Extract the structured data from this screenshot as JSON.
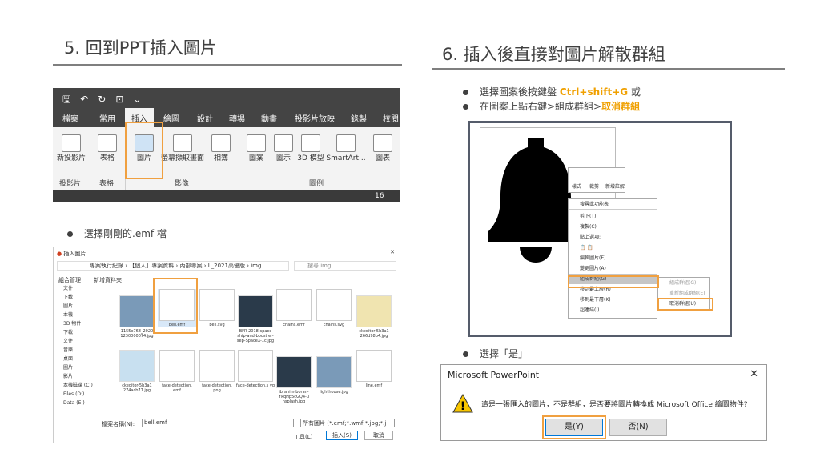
{
  "left": {
    "title": "5. 回到PPT插入圖片",
    "bullet": "選擇剛剛的.emf 檔"
  },
  "right": {
    "title": "6. 插入後直接對圖片解散群組",
    "bullet1": {
      "pre": "選擇圖案後按鍵盤 ",
      "key": "Ctrl+shift+G",
      "post": " 或"
    },
    "bullet2": {
      "pre": "在圖案上點右鍵>組成群組>",
      "key": "取消群組"
    },
    "bullet3": "選擇「是」"
  },
  "ribbon": {
    "tabs": [
      "檔案",
      "常用",
      "插入",
      "繪圖",
      "設計",
      "轉場",
      "動畫",
      "投影片放映",
      "錄製",
      "校閱"
    ],
    "buttons": [
      "新投影片",
      "表格",
      "圖片",
      "螢幕擷取畫面",
      "相簿",
      "圖案",
      "圖示",
      "3D 模型",
      "SmartArt...",
      "圖表"
    ],
    "groups": [
      "投影片",
      "表格",
      "影像",
      "圖例"
    ],
    "zoom": "16"
  },
  "dialog": {
    "title": "插入圖片",
    "path": [
      "專案執行紀錄",
      "【個人】專案資料",
      "內部專案",
      "L_2021高優版",
      "img"
    ],
    "search": "搜尋 img",
    "organize": "組合管理",
    "new_folder": "新增資料夾",
    "nav": [
      "文件",
      "下載",
      "圖片",
      "本機",
      "3D 物件",
      "下載",
      "文件",
      "音樂",
      "桌面",
      "圖片",
      "影片",
      "本機磁碟 (C:)",
      "Files (D:)",
      "Data (E:)"
    ],
    "files": [
      "1155x768_2020 1230000074.jpg",
      "bell.emf",
      "bell.svg",
      "BFR-2018-space ship-and-boost er-sep-SpaceX-1c.jpg",
      "chains.emf",
      "chains.svg",
      "ckeditor-5b3a1 266d98b4.jpg",
      "ckeditor-5b3a1 274acb77.jpg",
      "face-detection. emf",
      "face-detection. png",
      "face-detection.s vg",
      "ibrahim-boran- YkqHp5cGQ4-u nsplash.jpg",
      "lighthouse.jpg",
      "line.emf"
    ],
    "filename_label": "檔案名稱(N):",
    "filename": "bell.emf",
    "filter": "所有圖片 (*.emf;*.wmf;*.jpg;*.j",
    "tools": "工具(L)",
    "insert": "插入(S)",
    "cancel": "取消"
  },
  "context": {
    "mini": [
      "樣式",
      "裁剪",
      "新增註解"
    ],
    "search": "搜尋此功能表",
    "items": [
      "剪下(T)",
      "複製(C)",
      "貼上選項:",
      "",
      "編輯圖片(E)",
      "變更圖片(A)",
      "組成群組(G)",
      "移到最上層(R)",
      "移到最下層(K)",
      "超連結(I)"
    ],
    "submenu": [
      "組成群組(G)",
      "重新組成群組(E)",
      "取消群組(U)"
    ]
  },
  "msgbox": {
    "title": "Microsoft PowerPoint",
    "message": "這是一張匯入的圖片，不是群組，是否要將圖片轉換成 Microsoft Office 繪圖物件?",
    "yes": "是(Y)",
    "no": "否(N)"
  }
}
